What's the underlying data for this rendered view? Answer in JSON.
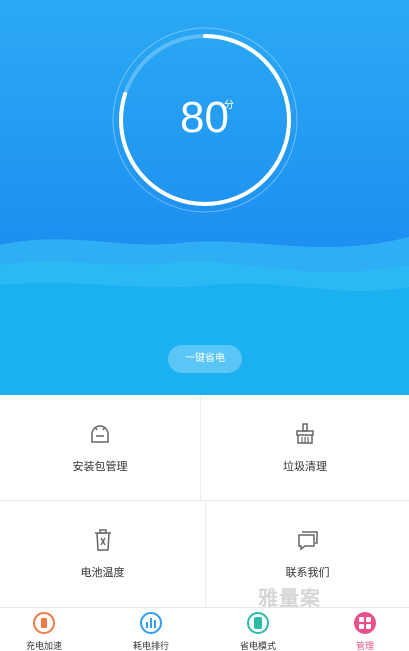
{
  "gauge": {
    "score": "80",
    "unit": "分",
    "progress": 0.8
  },
  "actions": {
    "one_key_save": "一键省电"
  },
  "grid": [
    {
      "label": "安装包管理",
      "icon": "android-icon"
    },
    {
      "label": "垃圾清理",
      "icon": "broom-icon"
    },
    {
      "label": "电池温度",
      "icon": "trash-icon"
    },
    {
      "label": "联系我们",
      "icon": "chat-icon"
    }
  ],
  "tabs": [
    {
      "label": "充电加速",
      "icon": "battery-charge-icon",
      "color": "#f27a44"
    },
    {
      "label": "耗电排行",
      "icon": "bar-chart-icon",
      "color": "#2f9ef4"
    },
    {
      "label": "省电模式",
      "icon": "battery-mode-icon",
      "color": "#2bbca8"
    },
    {
      "label": "管理",
      "icon": "grid-icon",
      "color": "#e8518b"
    }
  ],
  "watermark": "雅量案",
  "colors": {
    "primary": "#1e90f0",
    "active_tab": "#e8518b"
  }
}
